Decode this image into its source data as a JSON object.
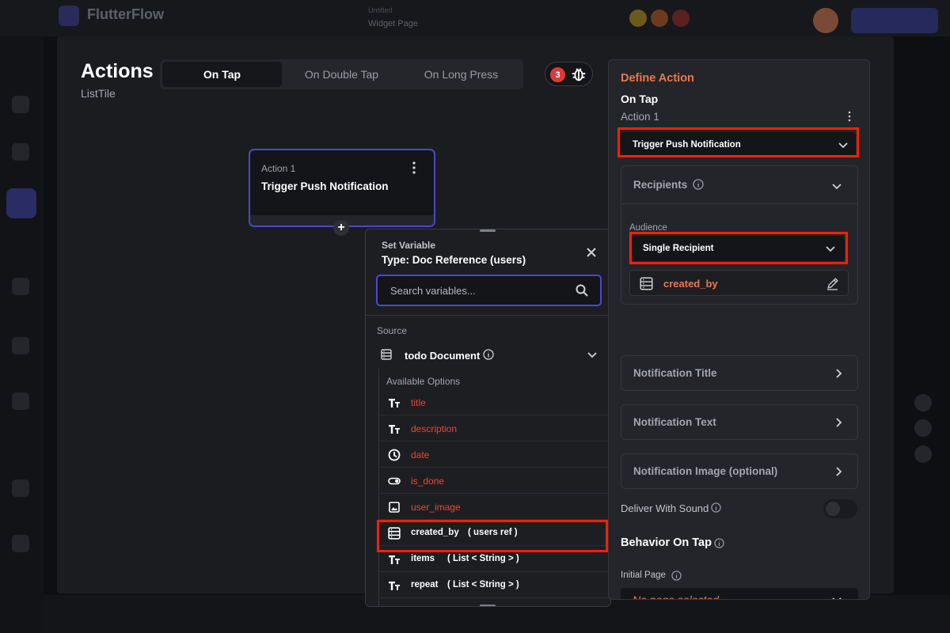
{
  "background_app": {
    "app_title": "FlutterFlow",
    "project_hint": "Untitled",
    "project_name": "Widget Page"
  },
  "header": {
    "title": "Actions",
    "subtitle": "ListTile",
    "tabs": [
      {
        "label": "On Tap",
        "active": true
      },
      {
        "label": "On Double Tap",
        "active": false
      },
      {
        "label": "On Long Press",
        "active": false
      }
    ],
    "debug_count": "3"
  },
  "node": {
    "label": "Action 1",
    "title": "Trigger Push Notification",
    "add_symbol": "+"
  },
  "picker": {
    "label": "Set Variable",
    "type": "Type: Doc Reference (users)",
    "search_placeholder": "Search variables...",
    "source_label": "Source",
    "document_label": "todo Document",
    "available_label": "Available Options",
    "items": [
      {
        "name": "title",
        "type": "",
        "icon": "text-type-icon",
        "highlight": false
      },
      {
        "name": "description",
        "type": "",
        "icon": "text-type-icon",
        "highlight": false
      },
      {
        "name": "date",
        "type": "",
        "icon": "clock-icon",
        "highlight": false
      },
      {
        "name": "is_done",
        "type": "",
        "icon": "toggle-icon",
        "highlight": false
      },
      {
        "name": "user_image",
        "type": "",
        "icon": "image-icon",
        "highlight": false
      },
      {
        "name": "created_by",
        "type": "( users ref )",
        "icon": "doc-ref-icon",
        "highlight": true
      },
      {
        "name": "items",
        "type": "( List < String > )",
        "icon": "text-type-icon",
        "highlight": false
      },
      {
        "name": "repeat",
        "type": "( List < String > )",
        "icon": "text-type-icon",
        "highlight": false
      }
    ]
  },
  "panel": {
    "title": "Define Action",
    "trigger": "On Tap",
    "action_label": "Action 1",
    "action_value": "Trigger Push Notification",
    "recipients_label": "Recipients",
    "audience_label": "Audience",
    "audience_value": "Single Recipient",
    "recipient_field": "created_by",
    "notification_title_label": "Notification Title",
    "notification_text_label": "Notification Text",
    "notification_image_label": "Notification Image (optional)",
    "sound_label": "Deliver With Sound",
    "sound_enabled": false,
    "behavior_label": "Behavior On Tap",
    "initial_page_label": "Initial Page",
    "initial_page_value": "No page selected"
  },
  "colors": {
    "accent_purple": "#4b48d4",
    "accent_orange": "#e8794a",
    "field_red": "#e4493a",
    "highlight_red": "#ff1e00",
    "badge_red": "#e03838"
  }
}
